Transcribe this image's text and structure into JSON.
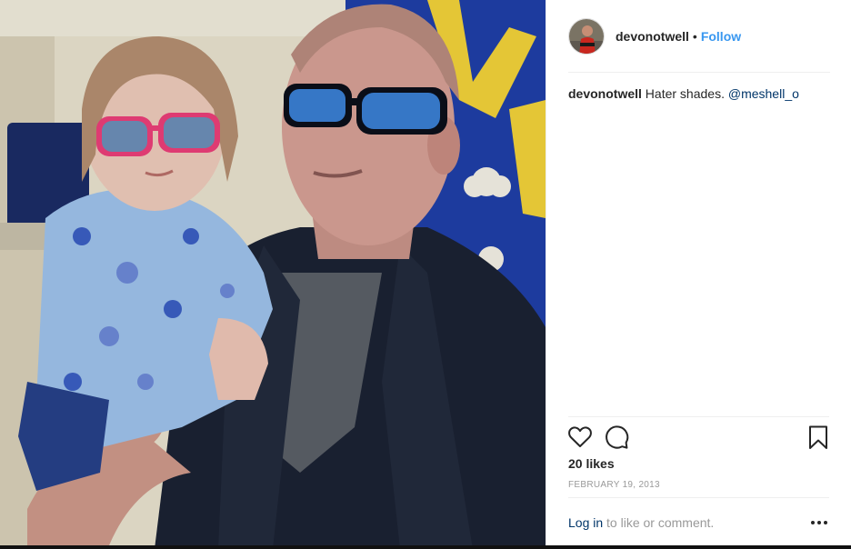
{
  "post": {
    "username": "devonotwell",
    "separator": "•",
    "follow_label": "Follow",
    "caption": {
      "username": "devonotwell",
      "text": "Hater shades.",
      "mention": "@meshell_o"
    },
    "likes": "20 likes",
    "date": "FEBRUARY 19, 2013",
    "footer": {
      "login_label": "Log in",
      "rest": " to like or comment."
    }
  },
  "icons": {
    "like": "heart-outline-icon",
    "comment": "speech-bubble-icon",
    "save": "bookmark-icon",
    "more": "ellipsis-icon"
  },
  "colors": {
    "follow": "#3897f0",
    "mention": "#003569",
    "muted": "#999999",
    "text": "#262626"
  }
}
